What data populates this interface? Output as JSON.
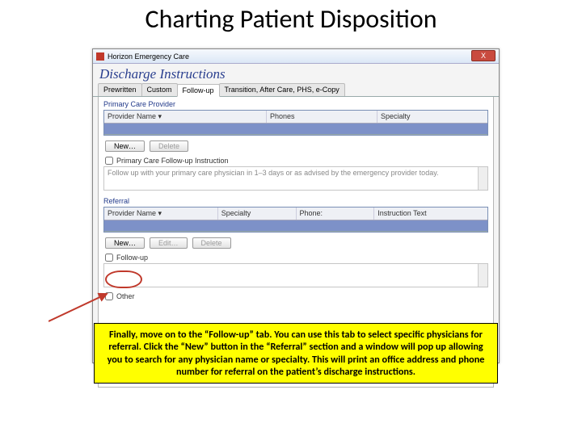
{
  "slide_title": "Charting Patient Disposition",
  "window": {
    "app_name": "Horizon Emergency Care",
    "close_glyph": "X",
    "dialog_title": "Discharge Instructions"
  },
  "tabs": {
    "t0": "Prewritten",
    "t1": "Custom",
    "t2": "Follow-up",
    "t3": "Transition, After Care, PHS, e-Copy"
  },
  "primary": {
    "group": "Primary Care Provider",
    "col_provider": "Provider Name",
    "col_phone": "Phones",
    "col_specialty": "Specialty",
    "btn_new": "New…",
    "btn_delete": "Delete",
    "chk_label": "Primary Care Follow-up Instruction",
    "default_text": "Follow up with your primary care physician in 1–3 days or as advised by the emergency provider today."
  },
  "referral": {
    "group": "Referral",
    "col_provider": "Provider Name",
    "col_specialty": "Specialty",
    "col_phone": "Phone:",
    "col_instr": "Instruction Text",
    "btn_new": "New…",
    "btn_edit": "Edit…",
    "btn_delete": "Delete",
    "chk_label": "Follow-up",
    "other": "Other"
  },
  "caption": "Finally, move on to the “Follow-up” tab. You can use this tab to select specific physicians for referral. Click the “New” button in the “Referral” section and a window will pop up allowing you to search for any physician name or specialty. This will print an office address and phone number for referral on the patient’s discharge instructions."
}
